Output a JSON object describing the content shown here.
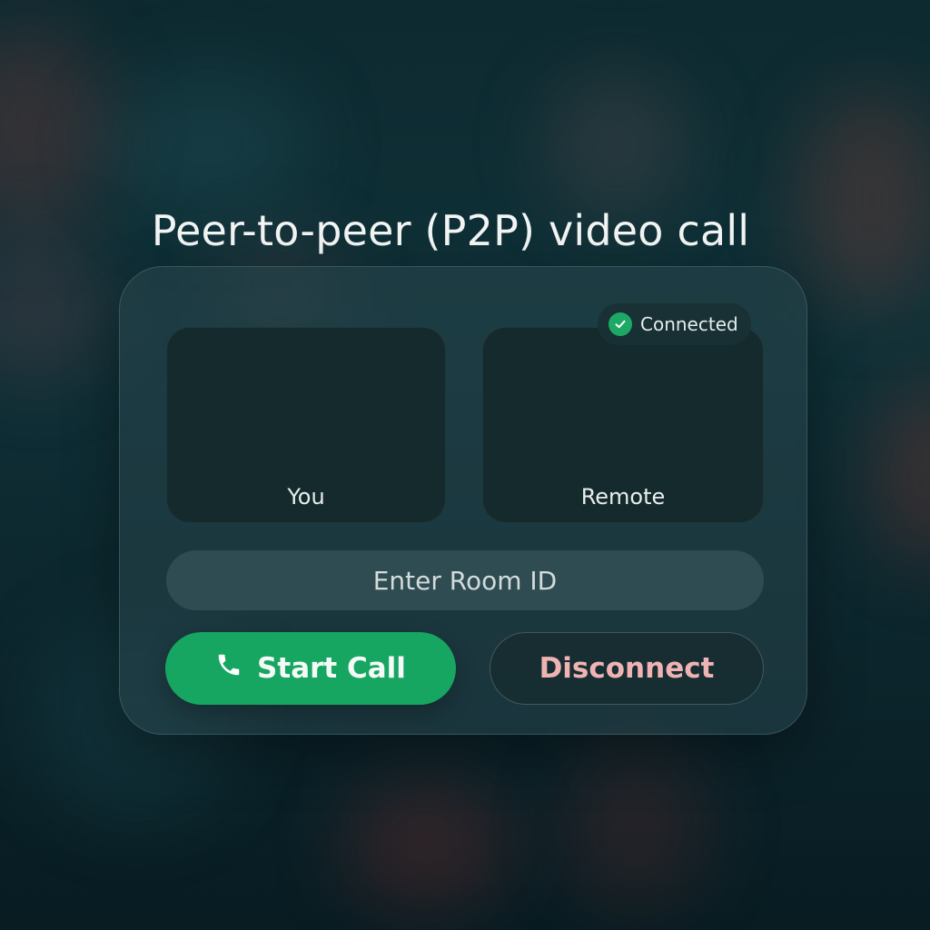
{
  "title": "Peer-to-peer (P2P) video call",
  "videos": {
    "local_label": "You",
    "remote_label": "Remote"
  },
  "status": {
    "text": "Connected",
    "icon": "check-circle-icon",
    "color": "#1ea866"
  },
  "room_input": {
    "placeholder": "Enter Room ID",
    "value": ""
  },
  "actions": {
    "start_label": "Start Call",
    "start_icon": "phone-icon",
    "start_color": "#17a661",
    "disconnect_label": "Disconnect",
    "disconnect_color": "#f0b3b3"
  }
}
